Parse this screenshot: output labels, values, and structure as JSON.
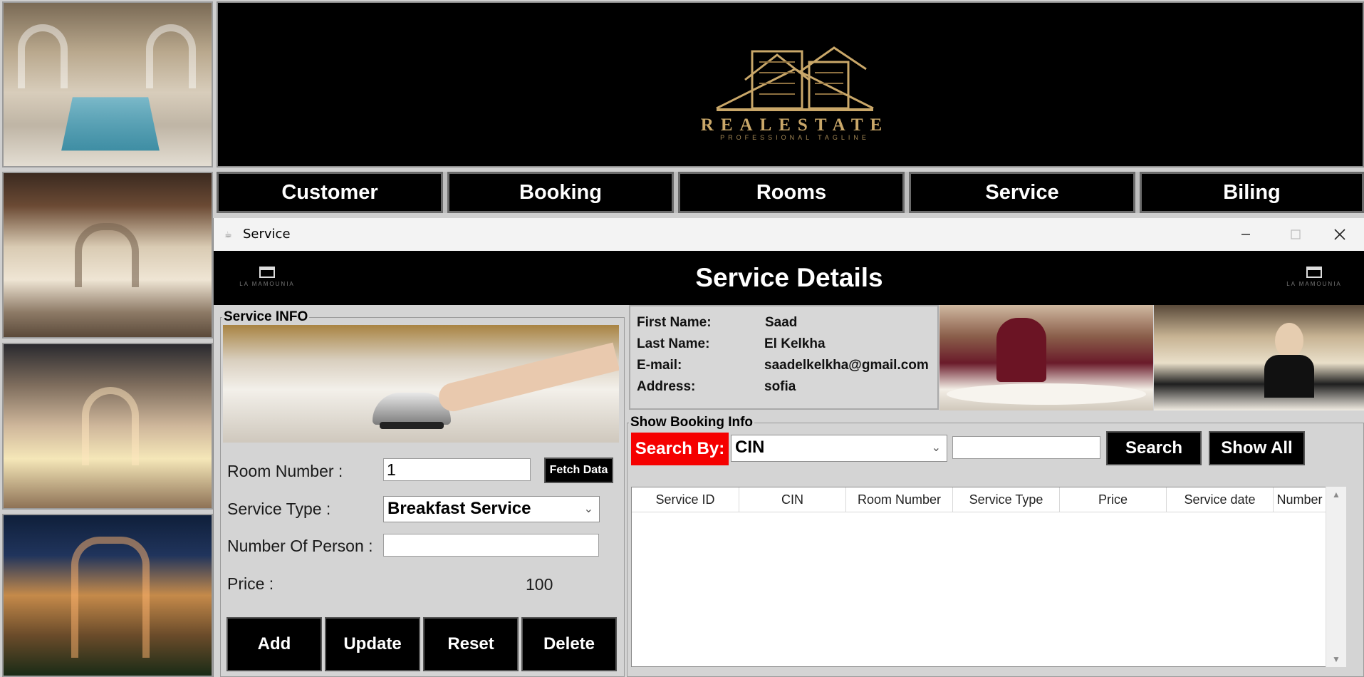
{
  "nav": {
    "items": [
      "Customer",
      "Booking",
      "Rooms",
      "Service",
      "Biling"
    ]
  },
  "banner": {
    "logo_text": "REALESTATE",
    "logo_tagline": "PROFESSIONAL TAGLINE"
  },
  "window": {
    "title": "Service",
    "header_title": "Service Details",
    "mini_logo": "LA MAMOUNIA"
  },
  "service_info": {
    "legend": "Service INFO",
    "room_number_label": "Room Number :",
    "room_number_value": "1",
    "fetch_label": "Fetch Data",
    "service_type_label": "Service Type :",
    "service_type_value": "Breakfast Service",
    "number_person_label": "Number Of Person :",
    "number_person_value": "",
    "price_label": "Price :",
    "price_value": "100",
    "buttons": [
      "Add",
      "Update",
      "Reset",
      "Delete"
    ]
  },
  "customer": {
    "first_name_label": "First Name:",
    "first_name": "Saad",
    "last_name_label": "Last Name:",
    "last_name": "El Kelkha",
    "email_label": "E-mail:",
    "email": "saadelkelkha@gmail.com",
    "address_label": "Address:",
    "address": "sofia"
  },
  "booking": {
    "legend": "Show Booking Info",
    "search_by_label": "Search By:",
    "search_by_value": "CIN",
    "search_input": "",
    "search_button": "Search",
    "show_all_button": "Show All",
    "columns": [
      "Service ID",
      "CIN",
      "Room Number",
      "Service Type",
      "Price",
      "Service date",
      "Number"
    ]
  },
  "colors": {
    "accent_red": "#f50000",
    "gold": "#c9a769",
    "black": "#000000"
  }
}
